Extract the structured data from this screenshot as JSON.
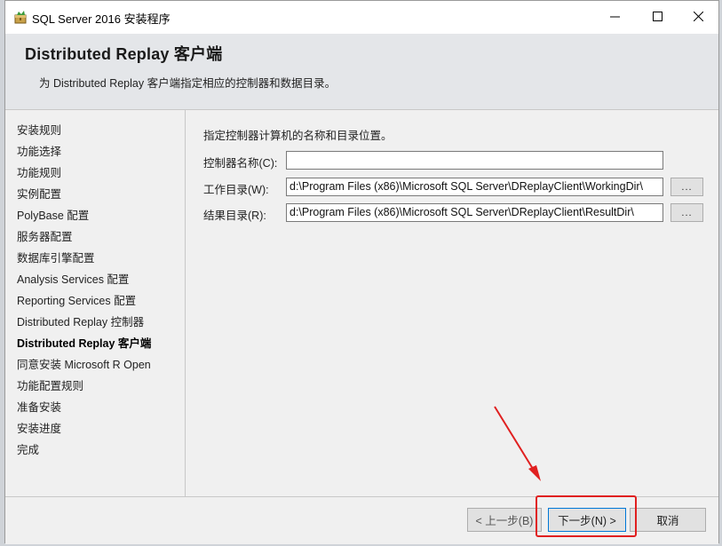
{
  "window": {
    "title": "SQL Server 2016 安装程序"
  },
  "header": {
    "title": "Distributed  Replay 客户端",
    "subtitle": "为 Distributed Replay 客户端指定相应的控制器和数据目录。"
  },
  "nav": {
    "items": [
      {
        "label": "安装规则",
        "active": false
      },
      {
        "label": "功能选择",
        "active": false
      },
      {
        "label": "功能规则",
        "active": false
      },
      {
        "label": "实例配置",
        "active": false
      },
      {
        "label": "PolyBase 配置",
        "active": false
      },
      {
        "label": "服务器配置",
        "active": false
      },
      {
        "label": "数据库引擎配置",
        "active": false
      },
      {
        "label": "Analysis Services 配置",
        "active": false
      },
      {
        "label": "Reporting Services 配置",
        "active": false
      },
      {
        "label": "Distributed Replay 控制器",
        "active": false
      },
      {
        "label": "Distributed Replay 客户端",
        "active": true
      },
      {
        "label": "同意安装 Microsoft R Open",
        "active": false
      },
      {
        "label": "功能配置规则",
        "active": false
      },
      {
        "label": "准备安装",
        "active": false
      },
      {
        "label": "安装进度",
        "active": false
      },
      {
        "label": "完成",
        "active": false
      }
    ]
  },
  "main": {
    "description": "指定控制器计算机的名称和目录位置。",
    "controller": {
      "label": "控制器名称(C):",
      "value": ""
    },
    "working_dir": {
      "label": "工作目录(W):",
      "value": "d:\\Program Files (x86)\\Microsoft SQL Server\\DReplayClient\\WorkingDir\\",
      "browse": "..."
    },
    "result_dir": {
      "label": "结果目录(R):",
      "value": "d:\\Program Files (x86)\\Microsoft SQL Server\\DReplayClient\\ResultDir\\",
      "browse": "..."
    }
  },
  "footer": {
    "back_label": "< 上一步(B)",
    "next_label": "下一步(N) >",
    "cancel_label": "取消"
  },
  "annotation": {
    "color": "#e02020"
  }
}
